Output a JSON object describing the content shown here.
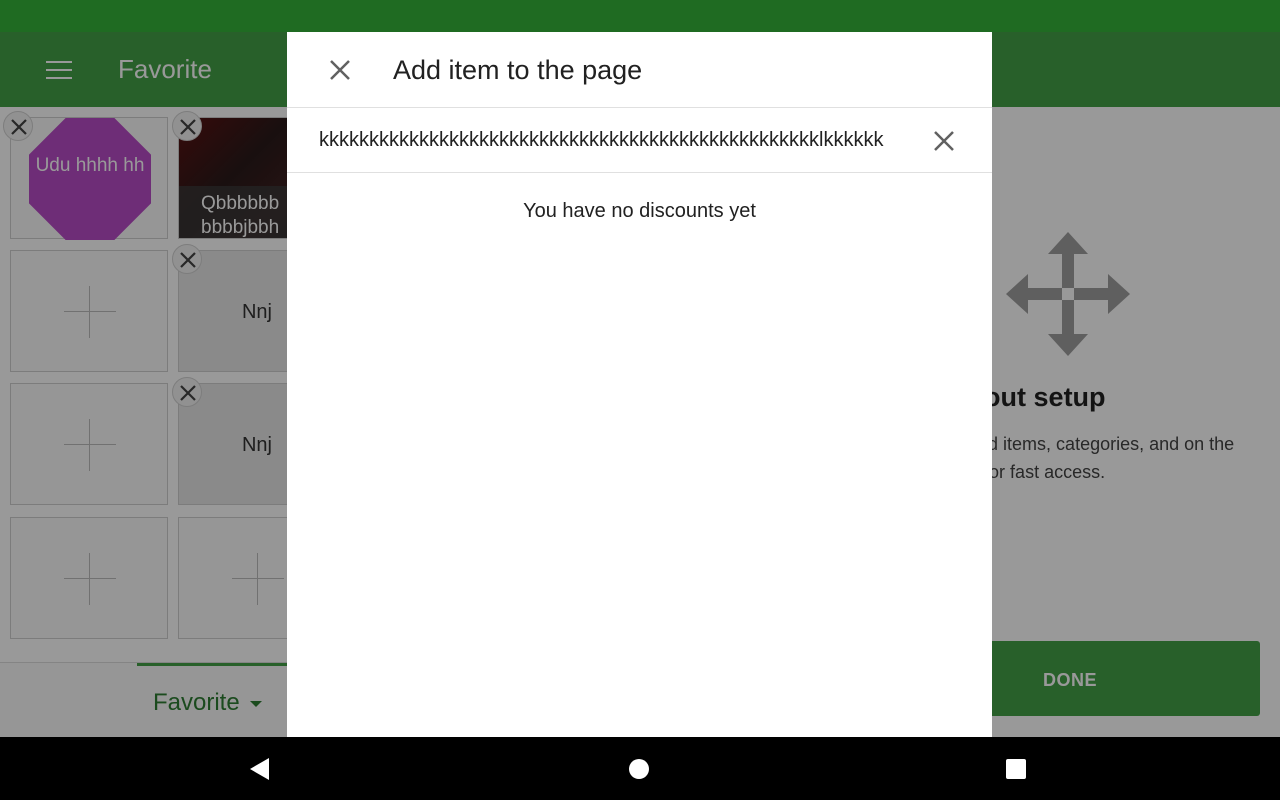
{
  "app": {
    "title": "Favorite",
    "tiles": [
      {
        "label": "Udu hhhh hh"
      },
      {
        "label": "Qbbbbbb bbbbjbbh"
      },
      {
        "label": "Nnj"
      },
      {
        "label": "Nnj"
      }
    ],
    "bottom_tab": {
      "label": "Favorite"
    },
    "setup": {
      "title": "em layout setup",
      "description": "ost used items, categories, and on the pages for fast access.",
      "done_label": "DONE"
    }
  },
  "dialog": {
    "title": "Add item to the page",
    "search_value": "kkkkkkkkkkkkkkkkkkkkkkkkkkkkkkkkkkkkkkkkkkkkkkkkkklkkkkkk",
    "empty_message": "You have no discounts yet"
  },
  "colors": {
    "status_bar": "#1f6b22",
    "accent": "#43a047",
    "tile_purple": "#b84bc6"
  }
}
